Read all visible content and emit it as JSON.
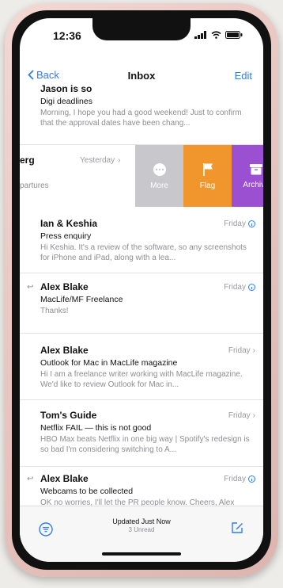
{
  "status": {
    "time": "12:36"
  },
  "nav": {
    "back_label": "Back",
    "title": "Inbox",
    "edit_label": "Edit"
  },
  "top_email": {
    "from": "Jason is so",
    "date": "",
    "subject": "Digi deadlines",
    "preview": "Morning, I hope you had a good weekend! Just to confirm that the approval dates have been chang..."
  },
  "swiped_email": {
    "from_fragment": "erg",
    "date": "Yesterday",
    "preview_fragment": "partures"
  },
  "swipe_actions": [
    {
      "label": "More",
      "icon": "more-icon",
      "color": "#c7c7cc"
    },
    {
      "label": "Flag",
      "icon": "flag-icon",
      "color": "#f0962d"
    },
    {
      "label": "Archive",
      "icon": "archive-icon",
      "color": "#9b4fd1"
    }
  ],
  "emails": [
    {
      "from": "Ian & Keshia",
      "date": "Friday",
      "subject": "Press enquiry",
      "preview": "Hi Keshia. It's a review of the software, so any screenshots for iPhone and iPad, along with a lea..."
    },
    {
      "from": "Alex Blake",
      "date": "Friday",
      "subject": "MacLife/MF Freelance",
      "preview": "Thanks!"
    },
    {
      "from": "Alex Blake",
      "date": "Friday",
      "subject": "Outlook for Mac in MacLife magazine",
      "preview": "Hi I am a freelance writer working with MacLife magazine. We'd like to review Outlook for Mac in..."
    },
    {
      "from": "Tom's Guide",
      "date": "Friday",
      "subject": "Netflix FAIL — this is not good",
      "preview": "HBO Max beats Netflix in one big way | Spotify's redesign is so bad I'm considering switching to A..."
    },
    {
      "from": "Alex Blake",
      "date": "Friday",
      "subject": "Webcams to be collected",
      "preview": "OK no worries, I'll let the PR people know. Cheers, Alex"
    }
  ],
  "toolbar": {
    "updated": "Updated Just Now",
    "unread": "3 Unread"
  },
  "colors": {
    "accent": "#2f7cf6",
    "flag": "#f0962d",
    "archive": "#9b4fd1",
    "more": "#c7c7cc"
  }
}
